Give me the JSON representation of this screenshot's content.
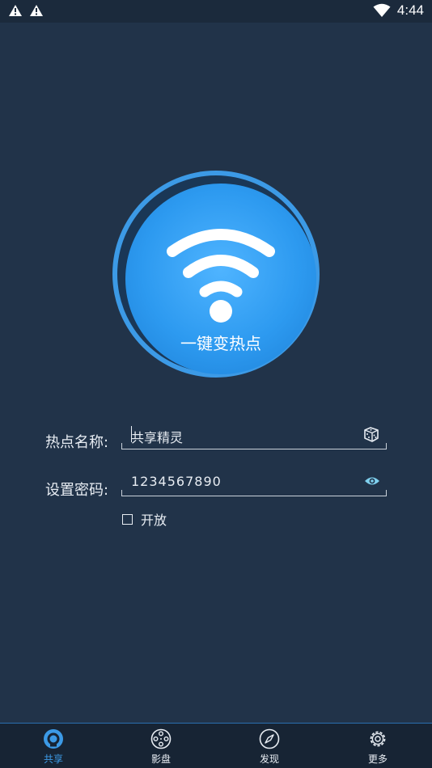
{
  "status_bar": {
    "time": "4:44",
    "icons": [
      "warning-icon",
      "warning-icon",
      "wifi-signal-icon"
    ]
  },
  "hotspot": {
    "label": "一键变热点",
    "icon": "wifi-icon"
  },
  "form": {
    "name_label": "热点名称:",
    "name_value": "共享精灵",
    "name_action_icon": "dice-icon",
    "password_label": "设置密码:",
    "password_value": "1234567890",
    "password_action_icon": "eye-icon",
    "open_label": "开放",
    "open_checked": false
  },
  "bottom_nav": {
    "items": [
      {
        "label": "共享",
        "icon": "share-icon",
        "active": true
      },
      {
        "label": "影盘",
        "icon": "film-reel-icon",
        "active": false
      },
      {
        "label": "发现",
        "icon": "compass-icon",
        "active": false
      },
      {
        "label": "更多",
        "icon": "gear-icon",
        "active": false
      }
    ]
  },
  "colors": {
    "background": "#213349",
    "accent": "#3c9ae6",
    "text": "#e8edf3"
  }
}
